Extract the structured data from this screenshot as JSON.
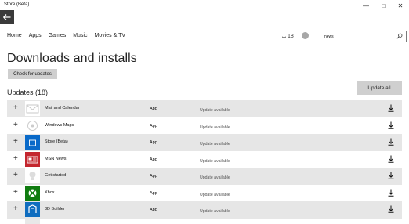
{
  "window": {
    "title": "Store (Beta)",
    "min": "—",
    "max": "□",
    "close": "✕"
  },
  "nav": {
    "items": [
      "Home",
      "Apps",
      "Games",
      "Music",
      "Movies & TV"
    ]
  },
  "header": {
    "downloads_count": "18",
    "search_value": "news"
  },
  "page": {
    "title": "Downloads and installs",
    "check_button": "Check for updates",
    "update_all_button": "Update all",
    "updates_heading": "Updates (18)"
  },
  "updates": [
    {
      "name": "Mail and Calendar",
      "type": "App",
      "status": "Update available",
      "icon": "mail-icon",
      "color": "#ffffff"
    },
    {
      "name": "Windows Maps",
      "type": "App",
      "status": "Update available",
      "icon": "maps-icon",
      "color": "#ffffff"
    },
    {
      "name": "Store (Beta)",
      "type": "App",
      "status": "Update available",
      "icon": "store-icon",
      "color": "#0a6ac9"
    },
    {
      "name": "MSN News",
      "type": "App",
      "status": "Update available",
      "icon": "news-icon",
      "color": "#c4262e"
    },
    {
      "name": "Get started",
      "type": "App",
      "status": "Update available",
      "icon": "lightbulb-icon",
      "color": "#ffffff"
    },
    {
      "name": "Xbox",
      "type": "App",
      "status": "Update available",
      "icon": "xbox-icon",
      "color": "#107c10"
    },
    {
      "name": "3D Builder",
      "type": "App",
      "status": "Update available",
      "icon": "3d-builder-icon",
      "color": "#0f6dbf"
    }
  ]
}
